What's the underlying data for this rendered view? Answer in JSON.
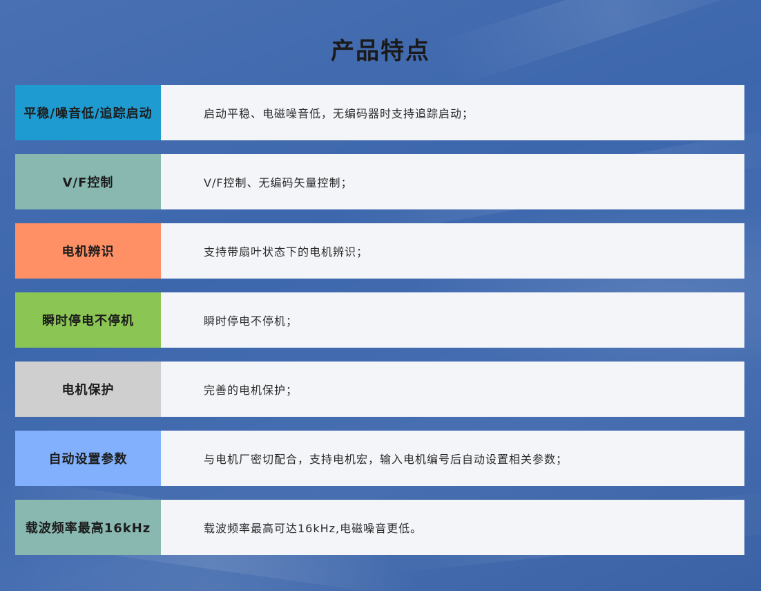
{
  "page": {
    "title": "产品特点"
  },
  "features": [
    {
      "label": "平稳/噪音低/追踪启动",
      "description": "启动平稳、电磁噪音低，无编码器时支持追踪启动；",
      "label_color": "#1e9bd1"
    },
    {
      "label": "V/F控制",
      "description": "V/F控制、无编码矢量控制；",
      "label_color": "#88b8b0"
    },
    {
      "label": "电机辨识",
      "description": "支持带扇叶状态下的电机辨识；",
      "label_color": "#ff8f64"
    },
    {
      "label": "瞬时停电不停机",
      "description": "瞬时停电不停机；",
      "label_color": "#8bc553"
    },
    {
      "label": "电机保护",
      "description": "完善的电机保护；",
      "label_color": "#cfcfcf"
    },
    {
      "label": "自动设置参数",
      "description": "与电机厂密切配合，支持电机宏，输入电机编号后自动设置相关参数；",
      "label_color": "#82b0fc"
    },
    {
      "label": "载波频率最高16kHz",
      "description": "载波频率最高可达16kHz,电磁噪音更低。",
      "label_color": "#88b8b0"
    }
  ],
  "colors": {
    "background": "#3d67ad",
    "row_background": "#f4f5f9"
  }
}
